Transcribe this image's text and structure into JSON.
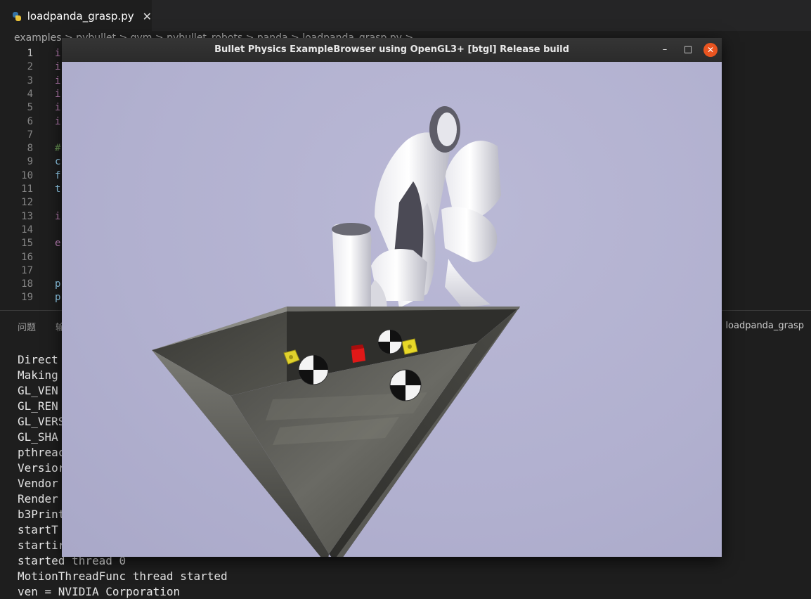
{
  "editor": {
    "tab_label": "loadpanda_grasp.py",
    "breadcrumb": "examples > pybullet > gym > pybullet_robots > panda > loadpanda_grasp.py >",
    "line_numbers": [
      "1",
      "2",
      "3",
      "4",
      "5",
      "6",
      "7",
      "8",
      "9",
      "10",
      "11",
      "12",
      "13",
      "14",
      "15",
      "16",
      "17",
      "18",
      "19"
    ],
    "code_fragments": [
      {
        "line": 1,
        "text": "i",
        "color": "#c586c0"
      },
      {
        "line": 2,
        "text": "i",
        "color": "#c586c0"
      },
      {
        "line": 3,
        "text": "i",
        "color": "#c586c0"
      },
      {
        "line": 4,
        "text": "i",
        "color": "#c586c0"
      },
      {
        "line": 5,
        "text": "i",
        "color": "#c586c0"
      },
      {
        "line": 6,
        "text": "i",
        "color": "#c586c0"
      },
      {
        "line": 8,
        "text": "#",
        "color": "#6a9955"
      },
      {
        "line": 9,
        "text": "c",
        "color": "#9cdcfe"
      },
      {
        "line": 10,
        "text": "f",
        "color": "#9cdcfe"
      },
      {
        "line": 11,
        "text": "t",
        "color": "#9cdcfe"
      },
      {
        "line": 13,
        "text": "i",
        "color": "#c586c0"
      },
      {
        "line": 15,
        "text": "e",
        "color": "#c586c0"
      },
      {
        "line": 18,
        "text": "p",
        "color": "#9cdcfe"
      },
      {
        "line": 19,
        "text": "p",
        "color": "#9cdcfe"
      }
    ]
  },
  "panel": {
    "tab_problems": "问题",
    "tab_output": "输",
    "run_label": "on: loadpanda_grasp",
    "terminal_lines": [
      "Direct",
      "Making",
      "GL_VEN",
      "GL_REN",
      "GL_VERS",
      "GL_SHA",
      "pthreac",
      "Versior",
      "Vendor",
      "Render",
      "b3Print",
      "startT",
      "startir",
      "started thread 0",
      "MotionThreadFunc thread started",
      "ven = NVIDIA Corporation"
    ]
  },
  "bullet_window": {
    "title": "Bullet Physics ExampleBrowser using OpenGL3+ [btgl] Release build",
    "minimize_glyph": "–",
    "maximize_glyph": "□",
    "close_glyph": "✕",
    "viewport_bg": "#b3b3cf",
    "scene_objects": {
      "robot": "Franka Panda arm",
      "tray": "dark metal tray",
      "cubes": [
        "yellow cube",
        "red cube",
        "yellow cube"
      ],
      "spheres": [
        "checker sphere",
        "checker sphere",
        "checker sphere"
      ]
    }
  }
}
